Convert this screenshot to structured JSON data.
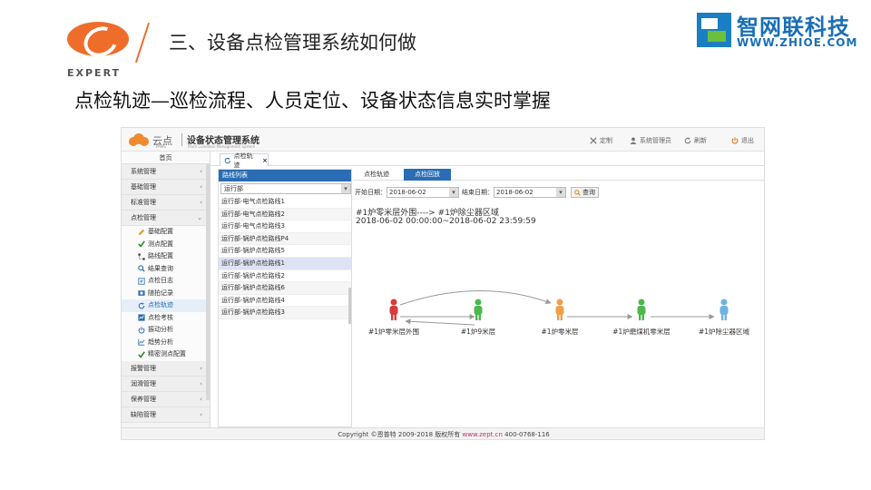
{
  "slide": {
    "logo_text": "EXPERT",
    "title": "三、设备点检管理系统如何做",
    "brand_cn": "智网联科技",
    "brand_url": "WWW.ZHIOE.COM",
    "subtitle": "点检轨迹—巡检流程、人员定位、设备状态信息实时掌握"
  },
  "app": {
    "brand": "云点",
    "brand_sub": "PAMS",
    "title": "设备状态管理系统",
    "title_en": "Plant Condition Management System",
    "top_actions": {
      "customize": "定制",
      "admin": "系统管理员",
      "refresh": "刷新",
      "logout": "退出"
    },
    "sidebar": {
      "home": "首页",
      "groups_before": [
        "系统管理",
        "基础管理",
        "标准管理"
      ],
      "active_group": "点检管理",
      "sub_items": [
        "基础配置",
        "测点配置",
        "路线配置",
        "结果查询",
        "点检日志",
        "随拍记录",
        "点检轨迹",
        "点检考核",
        "振动分析",
        "趋势分析",
        "精密测点配置"
      ],
      "groups_after": [
        "报警管理",
        "润滑管理",
        "保养管理",
        "缺陷管理"
      ]
    },
    "tab": {
      "label": "点检轨迹",
      "close": "×"
    },
    "route_list": {
      "header": "路线列表",
      "dept": "运行部",
      "rows": [
        "运行部-电气点检路线1",
        "运行部-电气点检路线2",
        "运行部-电气点检路线3",
        "运行部-锅炉点检路线P4",
        "运行部-锅炉点检路线5",
        "运行部-锅炉点检路线1",
        "运行部-锅炉点检路线2",
        "运行部-锅炉点检路线6",
        "运行部-锅炉点检路线4",
        "运行部-锅炉点检路线3"
      ]
    },
    "right": {
      "tabs": [
        "点检轨迹",
        "点检回放"
      ],
      "start_label": "开始日期：",
      "start_date": "2018-06-02",
      "end_label": "结束日期：",
      "end_date": "2018-06-02",
      "query": "查询",
      "route_title": "#1炉零米层外围----> #1炉除尘器区域",
      "route_time": "2018-06-02 00:00:00~2018-06-02 23:59:59",
      "nodes": [
        {
          "label": "#1炉零米层外围",
          "color": "#d93a3a"
        },
        {
          "label": "#1炉9米层",
          "color": "#4cb84c"
        },
        {
          "label": "#1炉零米层",
          "color": "#f0a04a"
        },
        {
          "label": "#1炉磨煤机零米层",
          "color": "#4cb84c"
        },
        {
          "label": "#1炉除尘器区域",
          "color": "#6fb2e0"
        }
      ]
    },
    "footer": {
      "copyright": "Copyright ©恩普特 2009-2018  版权所有",
      "site": "www.zept.cn",
      "phone": "400-0768-116"
    }
  }
}
